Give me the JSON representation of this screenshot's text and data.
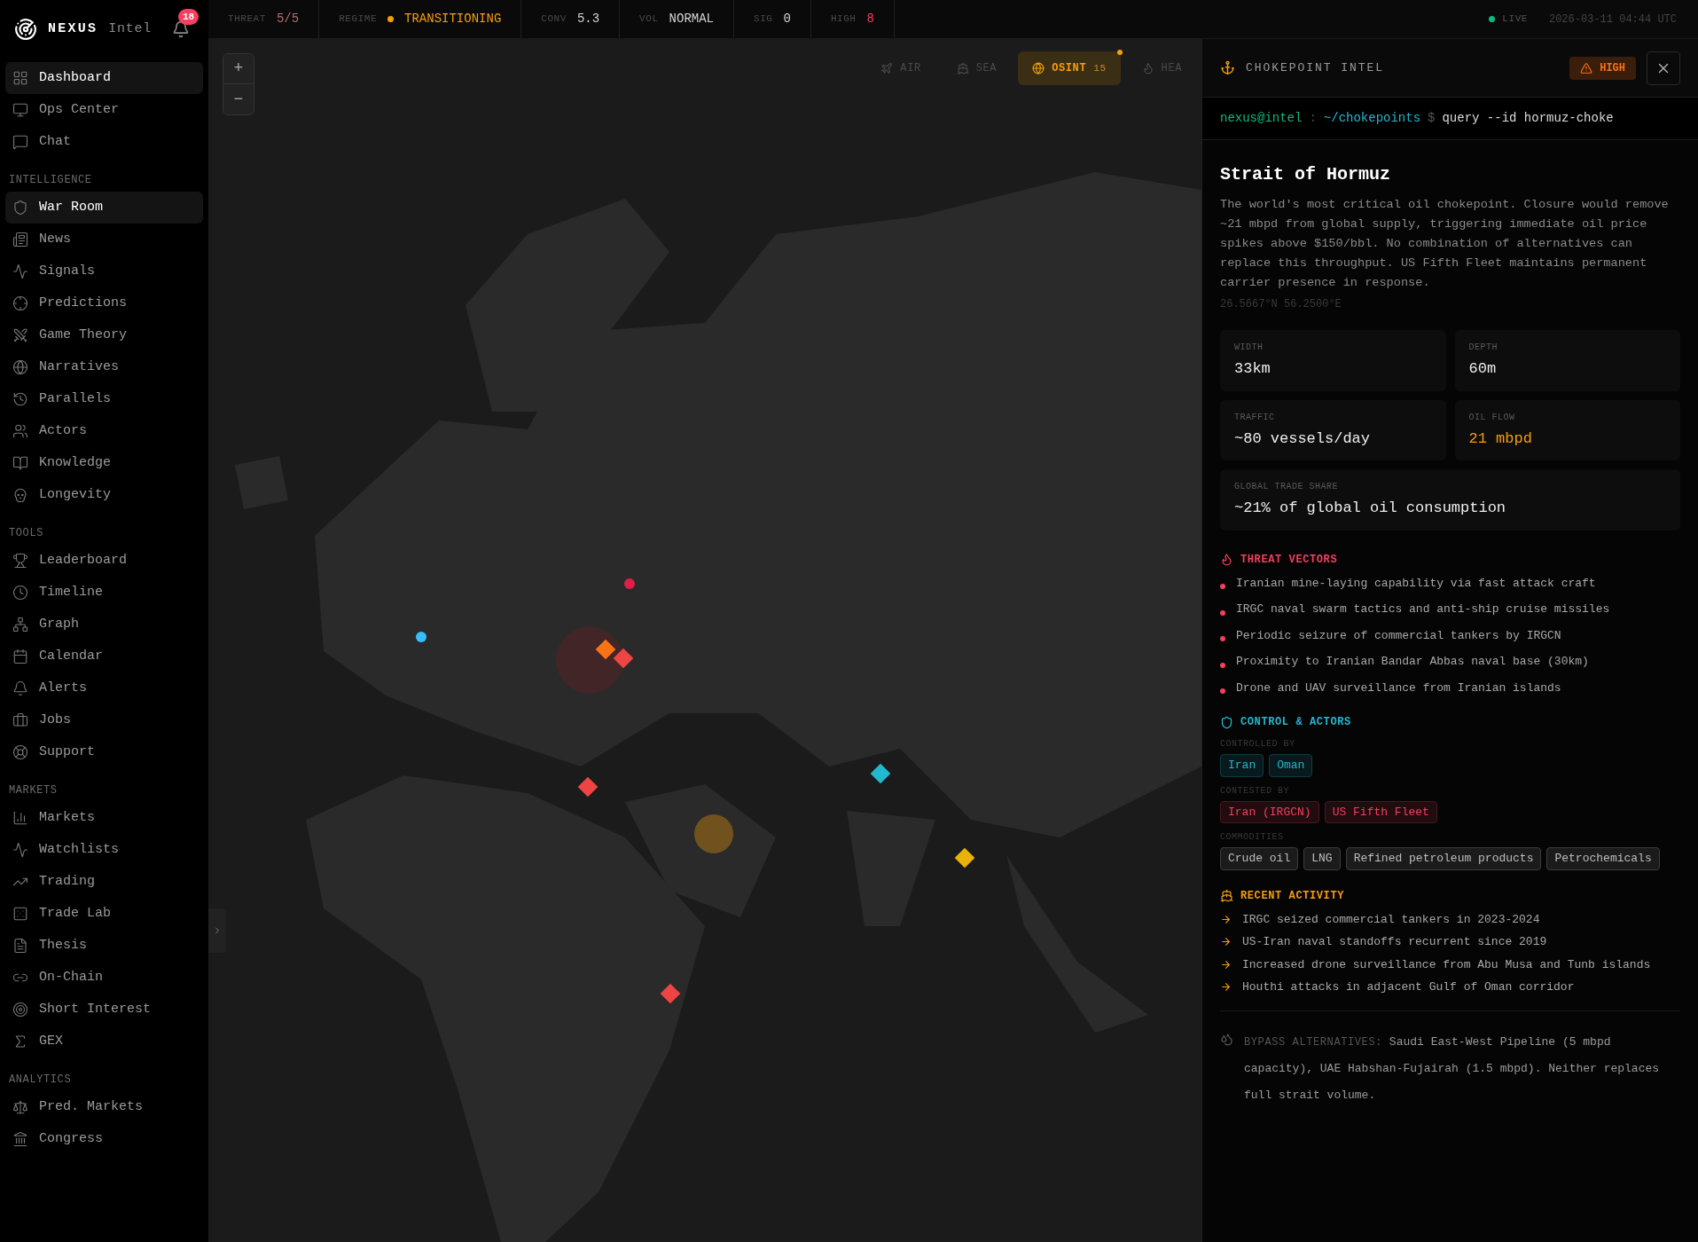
{
  "brand": {
    "name": "NEXUS",
    "sub": "Intel",
    "notifications": "18"
  },
  "top_bar": {
    "stats": [
      {
        "label": "THREAT",
        "value": "5/5",
        "color": "#b0706e",
        "dot": false
      },
      {
        "label": "REGIME",
        "value": "TRANSITIONING",
        "color": "#f59e0b",
        "dot": true
      },
      {
        "label": "CONV",
        "value": "5.3",
        "color": "#d4d4d4",
        "dot": false
      },
      {
        "label": "VOL",
        "value": "NORMAL",
        "color": "#d4d4d4",
        "dot": false
      },
      {
        "label": "SIG",
        "value": "0",
        "color": "#d4d4d4",
        "dot": false
      },
      {
        "label": "HIGH",
        "value": "8",
        "color": "#f43f5e",
        "dot": false
      }
    ],
    "live": "LIVE",
    "timestamp": "2026-03-11 04:44 UTC"
  },
  "sidebar": {
    "sections": [
      {
        "items": [
          {
            "label": "Dashboard",
            "selected": true
          },
          {
            "label": "Ops Center",
            "selected": false
          },
          {
            "label": "Chat",
            "selected": false
          }
        ]
      },
      {
        "title": "INTELLIGENCE",
        "items": [
          {
            "label": "War Room",
            "selected": true
          },
          {
            "label": "News",
            "selected": false
          },
          {
            "label": "Signals",
            "selected": false
          },
          {
            "label": "Predictions",
            "selected": false
          },
          {
            "label": "Game Theory",
            "selected": false
          },
          {
            "label": "Narratives",
            "selected": false
          },
          {
            "label": "Parallels",
            "selected": false
          },
          {
            "label": "Actors",
            "selected": false
          },
          {
            "label": "Knowledge",
            "selected": false
          },
          {
            "label": "Longevity",
            "selected": false
          }
        ]
      },
      {
        "title": "TOOLS",
        "items": [
          {
            "label": "Leaderboard",
            "selected": false
          },
          {
            "label": "Timeline",
            "selected": false
          },
          {
            "label": "Graph",
            "selected": false
          },
          {
            "label": "Calendar",
            "selected": false
          },
          {
            "label": "Alerts",
            "selected": false
          },
          {
            "label": "Jobs",
            "selected": false
          },
          {
            "label": "Support",
            "selected": false
          }
        ]
      },
      {
        "title": "MARKETS",
        "items": [
          {
            "label": "Markets",
            "selected": false
          },
          {
            "label": "Watchlists",
            "selected": false
          },
          {
            "label": "Trading",
            "selected": false
          },
          {
            "label": "Trade Lab",
            "selected": false
          },
          {
            "label": "Thesis",
            "selected": false
          },
          {
            "label": "On-Chain",
            "selected": false
          },
          {
            "label": "Short Interest",
            "selected": false
          },
          {
            "label": "GEX",
            "selected": false
          }
        ]
      },
      {
        "title": "ANALYTICS",
        "items": [
          {
            "label": "Pred. Markets",
            "selected": false
          },
          {
            "label": "Congress",
            "selected": false
          }
        ]
      }
    ]
  },
  "map": {
    "zoom_in": "+",
    "zoom_out": "−",
    "layers": [
      {
        "label": "AIR",
        "selected": false
      },
      {
        "label": "SEA",
        "selected": false
      },
      {
        "label": "OSINT",
        "count": "15",
        "selected": true
      },
      {
        "label": "HEA",
        "selected": false
      }
    ]
  },
  "panel": {
    "title": "CHOKEPOINT INTEL",
    "badge": "HIGH",
    "terminal": {
      "user": "nexus@intel",
      "sep": ":",
      "path": "~/chokepoints",
      "prompt": "$",
      "command": "query --id hormuz-choke"
    },
    "name": "Strait of Hormuz",
    "description": "The world's most critical oil chokepoint. Closure would remove ~21 mbpd from global supply, triggering immediate oil price spikes above $150/bbl. No combination of alternatives can replace this throughput. US Fifth Fleet maintains permanent carrier presence in response.",
    "coords": "26.5667°N 56.2500°E",
    "stats": [
      {
        "label": "WIDTH",
        "value": "33km",
        "color": "#ededed"
      },
      {
        "label": "DEPTH",
        "value": "60m",
        "color": "#ededed"
      },
      {
        "label": "TRAFFIC",
        "value": "~80 vessels/day",
        "color": "#ededed"
      },
      {
        "label": "OIL FLOW",
        "value": "21 mbpd",
        "color": "#f59e0b"
      },
      {
        "label": "GLOBAL TRADE SHARE",
        "value": "~21% of global oil consumption",
        "color": "#ededed"
      }
    ],
    "threats": {
      "title": "THREAT VECTORS",
      "items": [
        "Iranian mine-laying capability via fast attack craft",
        "IRGC naval swarm tactics and anti-ship cruise missiles",
        "Periodic seizure of commercial tankers by IRGCN",
        "Proximity to Iranian Bandar Abbas naval base (30km)",
        "Drone and UAV surveillance from Iranian islands"
      ]
    },
    "control": {
      "title": "CONTROL & ACTORS",
      "groups": [
        {
          "label": "CONTROLLED BY",
          "color": "#22b8cf",
          "tags": [
            "Iran",
            "Oman"
          ]
        },
        {
          "label": "CONTESTED BY",
          "color": "#f43f5e",
          "tags": [
            "Iran (IRGCN)",
            "US Fifth Fleet"
          ]
        },
        {
          "label": "COMMODITIES",
          "color": "#bdbdbd",
          "tags": [
            "Crude oil",
            "LNG",
            "Refined petroleum products",
            "Petrochemicals"
          ]
        }
      ]
    },
    "activity": {
      "title": "RECENT ACTIVITY",
      "items": [
        "IRGC seized commercial tankers in 2023-2024",
        "US-Iran naval standoffs recurrent since 2019",
        "Increased drone surveillance from Abu Musa and Tunb islands",
        "Houthi attacks in adjacent Gulf of Oman corridor"
      ]
    },
    "bypass": {
      "label": "BYPASS ALTERNATIVES:",
      "text": "Saudi East-West Pipeline (5 mbpd capacity), UAE Habshan-Fujairah (1.5 mbpd). Neither replaces full strait volume."
    }
  }
}
